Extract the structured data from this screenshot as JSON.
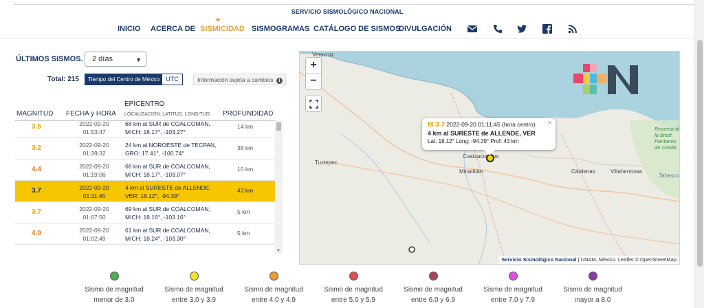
{
  "header": {
    "site_title": "SERVICIO SISMOLÓGICO NACIONAL",
    "nav": [
      {
        "label": "INICIO",
        "active": false
      },
      {
        "label": "ACERCA DE",
        "active": false
      },
      {
        "label": "SISMICIDAD",
        "active": true
      },
      {
        "label": "SISMOGRAMAS",
        "active": false
      },
      {
        "label": "CATÁLOGO DE SISMOS",
        "active": false
      },
      {
        "label": "DIVULGACIÓN",
        "active": false
      }
    ],
    "icons": [
      "mail-icon",
      "phone-icon",
      "twitter-icon",
      "facebook-icon",
      "rss-icon"
    ]
  },
  "panel": {
    "title": "ÚLTIMOS SISMOS.",
    "range_select": "2 días",
    "total_label": "Total:",
    "total_value": "215",
    "tz_active": "Tiempo del Centro de México",
    "tz_other": "UTC",
    "notice": "Información sujeta a cambios"
  },
  "table": {
    "headers": {
      "magnitude": "MAGNITUD",
      "datetime": "FECHA y HORA",
      "epicenter": "EPICENTRO",
      "epicenter_sub": "LOCALIZACIÓN: LATITUD, LONGITUD",
      "depth": "PROFUNDIDAD"
    },
    "rows": [
      {
        "mag": "3.5",
        "date": "2022-09-20",
        "time": "01:53:47",
        "ep1": "68 km al SUR de COALCOMAN,",
        "ep2": "MICH: 18.17°, -103.27°",
        "depth": "14 km",
        "color": "#e8a800",
        "selected": false
      },
      {
        "mag": "3.2",
        "date": "2022-09-20",
        "time": "01:39:32",
        "ep1": "24 km al NOROESTE de TECPAN,",
        "ep2": "GRO: 17.41°, -100.74°",
        "depth": "38 km",
        "color": "#e8a800",
        "selected": false
      },
      {
        "mag": "4.4",
        "date": "2022-09-20",
        "time": "01:19:06",
        "ep1": "68 km al SUR de COALCOMAN,",
        "ep2": "MICH: 18.17°, -103.07°",
        "depth": "10 km",
        "color": "#e87b20",
        "selected": false
      },
      {
        "mag": "3.7",
        "date": "2022-09-20",
        "time": "01:11:45",
        "ep1": "4 km al SURESTE de ALLENDE,",
        "ep2": "VER: 18.12°, -94.39°",
        "depth": "43 km",
        "color": "#1b2a4a",
        "selected": true
      },
      {
        "mag": "3.7",
        "date": "2022-09-20",
        "time": "01:07:50",
        "ep1": "69 km al SUR de COALCOMAN,",
        "ep2": "MICH: 18.16°, -103.16°",
        "depth": "5 km",
        "color": "#e8a800",
        "selected": false
      },
      {
        "mag": "4.0",
        "date": "2022-09-20",
        "time": "01:02:49",
        "ep1": "61 km al SUR de COALCOMAN,",
        "ep2": "MICH: 18.24°, -103.30°",
        "depth": "5 km",
        "color": "#e87b20",
        "selected": false
      }
    ]
  },
  "map": {
    "places": {
      "veracruz": "Veracruz",
      "tuxtepec": "Tuxtepec",
      "coatzacoalcos": "Coatzacoalcos",
      "minatitlan": "Minatitlán",
      "cardenas": "Cárdenas",
      "villahermosa": "Villahermosa",
      "tabasco": "Tabasco",
      "reserva": "Reserva de la Biosf. Pantanos de Centla"
    },
    "popup": {
      "mag": "M 3.7",
      "time": "2022-09-20  01:11:45 (hora centro)",
      "location": "4 km al SURESTE de ALLENDE, VER",
      "coords": "Lat: 18.12°  Long: -94.39°  Prof: 43 km"
    },
    "zoom_in": "+",
    "zoom_out": "−",
    "attribution_ssn": "Servicio Sismológico Nacional",
    "attribution_rest": " | UNAM, México.  Leaflet © OpenStreetMap"
  },
  "legend": [
    {
      "l1": "Sismo de magnitud",
      "l2": "menor de 3.0",
      "color": "#4caf50"
    },
    {
      "l1": "Sismo de magnitud",
      "l2": "entre 3.0 y 3.9",
      "color": "#f5e12a"
    },
    {
      "l1": "Sismo de magnitud",
      "l2": "entre 4.0 y 4.9",
      "color": "#f09a35"
    },
    {
      "l1": "Sismo de magnitud",
      "l2": "entre 5.0 y 5.9",
      "color": "#e05252"
    },
    {
      "l1": "Sismo de magnitud",
      "l2": "entre 6.0 y 6.9",
      "color": "#a8465a"
    },
    {
      "l1": "Sismo de magnitud",
      "l2": "entre 7.0 y 7.9",
      "color": "#e050e0"
    },
    {
      "l1": "Sismo de magnitud",
      "l2": "mayor a 8.0",
      "color": "#8e3aa8"
    }
  ]
}
